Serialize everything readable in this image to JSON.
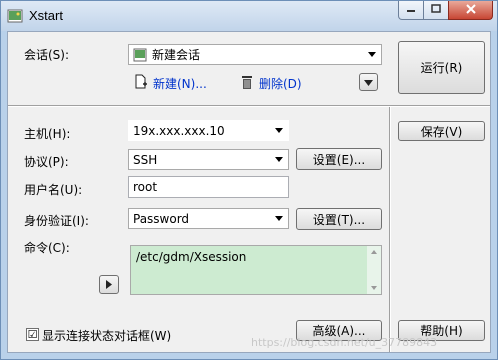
{
  "window": {
    "title": "Xstart"
  },
  "session": {
    "label": "会话(S):",
    "value": "新建会话",
    "new_label": "新建(N)...",
    "delete_label": "删除(D)",
    "run_label": "运行(R)"
  },
  "host": {
    "label": "主机(H):",
    "value": "19x.xxx.xxx.10"
  },
  "protocol": {
    "label": "协议(P):",
    "value": "SSH",
    "settings_label": "设置(E)..."
  },
  "save_label": "保存(V)",
  "username": {
    "label": "用户名(U):",
    "value": "root"
  },
  "auth": {
    "label": "身份验证(I):",
    "value": "Password",
    "settings_label": "设置(T)..."
  },
  "command": {
    "label": "命令(C):",
    "value": "/etc/gdm/Xsession"
  },
  "show_status": {
    "label": "显示连接状态对话框(W)",
    "checked": "☑"
  },
  "advanced_label": "高级(A)...",
  "help_label": "帮助(H)",
  "watermark": "https://blog.csdn.net/u_37789843"
}
